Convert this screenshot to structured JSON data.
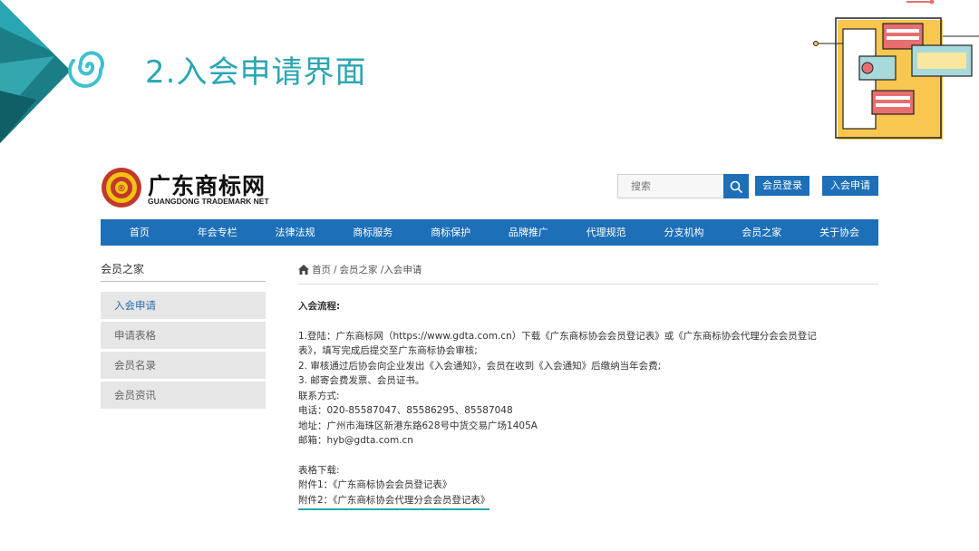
{
  "slide": {
    "title": "2.入会申请界面",
    "accent_color": "#2aa6b3"
  },
  "site": {
    "logo": {
      "name": "广东商标网",
      "english": "GUANGDONG TRADEMARK NET"
    },
    "search": {
      "placeholder": "搜索",
      "icon": "search-icon"
    },
    "header_buttons": {
      "login": "会员登录",
      "apply": "入会申请"
    },
    "nav": [
      "首页",
      "年会专栏",
      "法律法规",
      "商标服务",
      "商标保护",
      "品牌推广",
      "代理规范",
      "分支机构",
      "会员之家",
      "关于协会"
    ],
    "brand_color": "#1d6fb8",
    "sidebar": {
      "title": "会员之家",
      "items": [
        "入会申请",
        "申请表格",
        "会员名录",
        "会员资讯"
      ],
      "active": "入会申请"
    },
    "breadcrumb": {
      "home": "首页",
      "sep": "/",
      "path": "会员之家 /入会申请"
    },
    "content": {
      "process_title": "入会流程:",
      "step1_a": "1.登陆：广东商标网（https://www.gdta.com.cn）下载《广东商标协会会员登记表》或《广东商标协会代理分会会员登记",
      "step1_b": "表》，填写完成后提交至广东商标协会审核;",
      "step2": "2. 审核通过后协会向企业发出《入会通知》，会员在收到《入会通知》后缴纳当年会费;",
      "step3": "3. 邮寄会费发票、会员证书。",
      "contact_title": "联系方式:",
      "phone": "电话：020-85587047、85586295、85587048",
      "address": "地址：广州市海珠区新港东路628号中货交易广场1405A",
      "email": "邮箱：hyb@gdta.com.cn",
      "download_title": "表格下载:",
      "attach1": "附件1：《广东商标协会会员登记表》",
      "attach2": "附件2：《广东商标协会代理分会会员登记表》"
    }
  }
}
